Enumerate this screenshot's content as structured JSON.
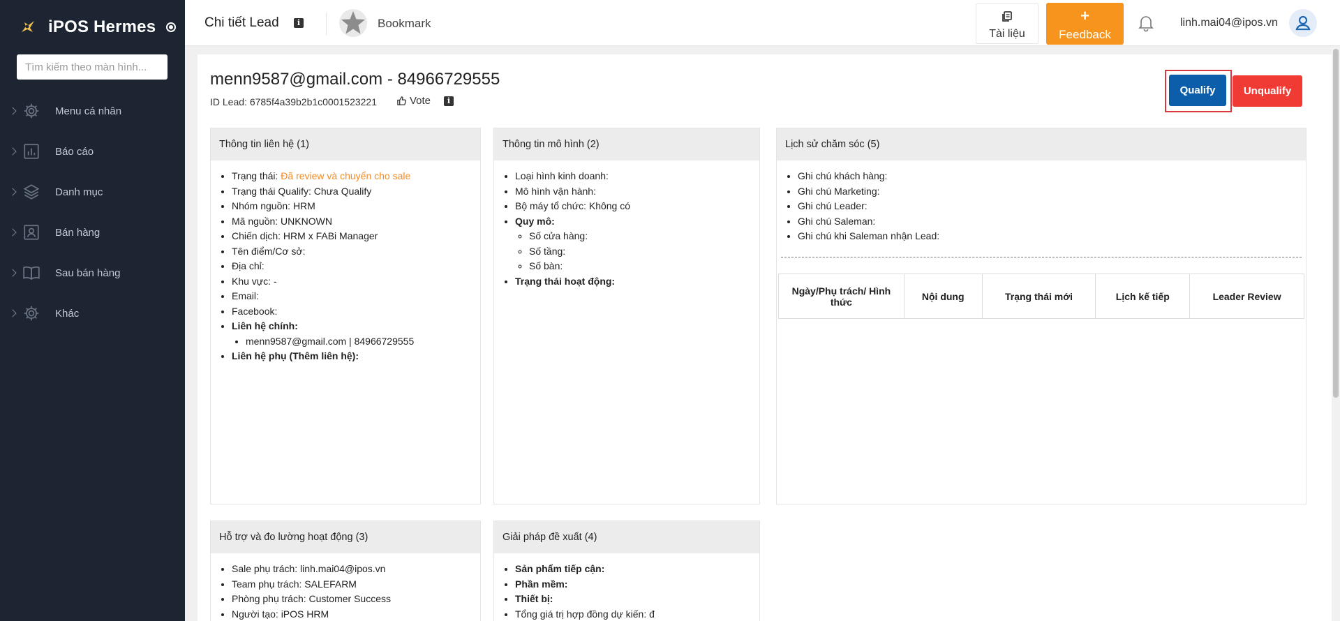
{
  "app": {
    "name": "iPOS Hermes",
    "search_placeholder": "Tìm kiếm theo màn hình..."
  },
  "sidebar": {
    "items": [
      {
        "label": "Menu cá nhân",
        "icon": "gear-icon"
      },
      {
        "label": "Báo cáo",
        "icon": "report-icon"
      },
      {
        "label": "Danh mục",
        "icon": "layers-icon"
      },
      {
        "label": "Bán hàng",
        "icon": "sales-icon"
      },
      {
        "label": "Sau bán hàng",
        "icon": "book-icon"
      },
      {
        "label": "Khác",
        "icon": "gear-icon"
      }
    ]
  },
  "header": {
    "title": "Chi tiết Lead",
    "bookmark_label": "Bookmark",
    "docs_label": "Tài liệu",
    "feedback_plus": "+",
    "feedback_label": "Feedback",
    "user_email": "linh.mai04@ipos.vn"
  },
  "lead": {
    "title": "menn9587@gmail.com - 84966729555",
    "id_text": "ID Lead: 6785f4a39b2b1c0001523221",
    "vote_label": "Vote",
    "qualify_label": "Qualify",
    "unqualify_label": "Unqualify"
  },
  "contact_card": {
    "title": "Thông tin liên hệ (1)",
    "status_label": "Trạng thái: ",
    "status_value": "Đã review và chuyển cho sale",
    "qualify_status": "Trạng thái Qualify: Chưa Qualify",
    "source_group": "Nhóm nguồn: HRM",
    "source_code": "Mã nguồn: UNKNOWN",
    "campaign": "Chiến dịch: HRM x FABi Manager",
    "place_name": "Tên điểm/Cơ sở:",
    "address": "Địa chỉ:",
    "region": "Khu vực: -",
    "email": "Email:",
    "facebook": "Facebook:",
    "main_contact_label": "Liên hệ chính:",
    "main_contact_value": "menn9587@gmail.com | 84966729555",
    "secondary_contact_label": "Liên hệ phụ (Thêm liên hệ):"
  },
  "model_card": {
    "title": "Thông tin mô hình (2)",
    "business_type": "Loại hình kinh doanh:",
    "operation_model": "Mô hình vận hành:",
    "org_structure": "Bộ máy tổ chức: Không có",
    "scale_label": "Quy mô:",
    "stores": "Số cửa hàng:",
    "floors": "Số tầng:",
    "tables": "Số bàn:",
    "activity_status": "Trạng thái hoạt động:"
  },
  "history_card": {
    "title": "Lịch sử chăm sóc (5)",
    "notes": [
      "Ghi chú khách hàng:",
      "Ghi chú Marketing:",
      "Ghi chú Leader:",
      "Ghi chú Saleman:",
      "Ghi chú khi Saleman nhận Lead:"
    ],
    "columns": [
      "Ngày/Phụ trách/ Hình thức",
      "Nội dung",
      "Trạng thái mới",
      "Lịch kế tiếp",
      "Leader Review"
    ]
  },
  "support_card": {
    "title": "Hỗ trợ và đo lường hoạt động (3)",
    "sale_owner": "Sale phụ trách: linh.mai04@ipos.vn",
    "team_owner": "Team phụ trách: SALEFARM",
    "dept_owner": "Phòng phụ trách: Customer Success",
    "creator": "Người tạo: iPOS HRM"
  },
  "solution_card": {
    "title": "Giải pháp đề xuất (4)",
    "product": "Sản phẩm tiếp cận:",
    "software": "Phần mềm:",
    "device": "Thiết bị:",
    "contract_value": "Tổng giá trị hợp đồng dự kiến: đ"
  }
}
